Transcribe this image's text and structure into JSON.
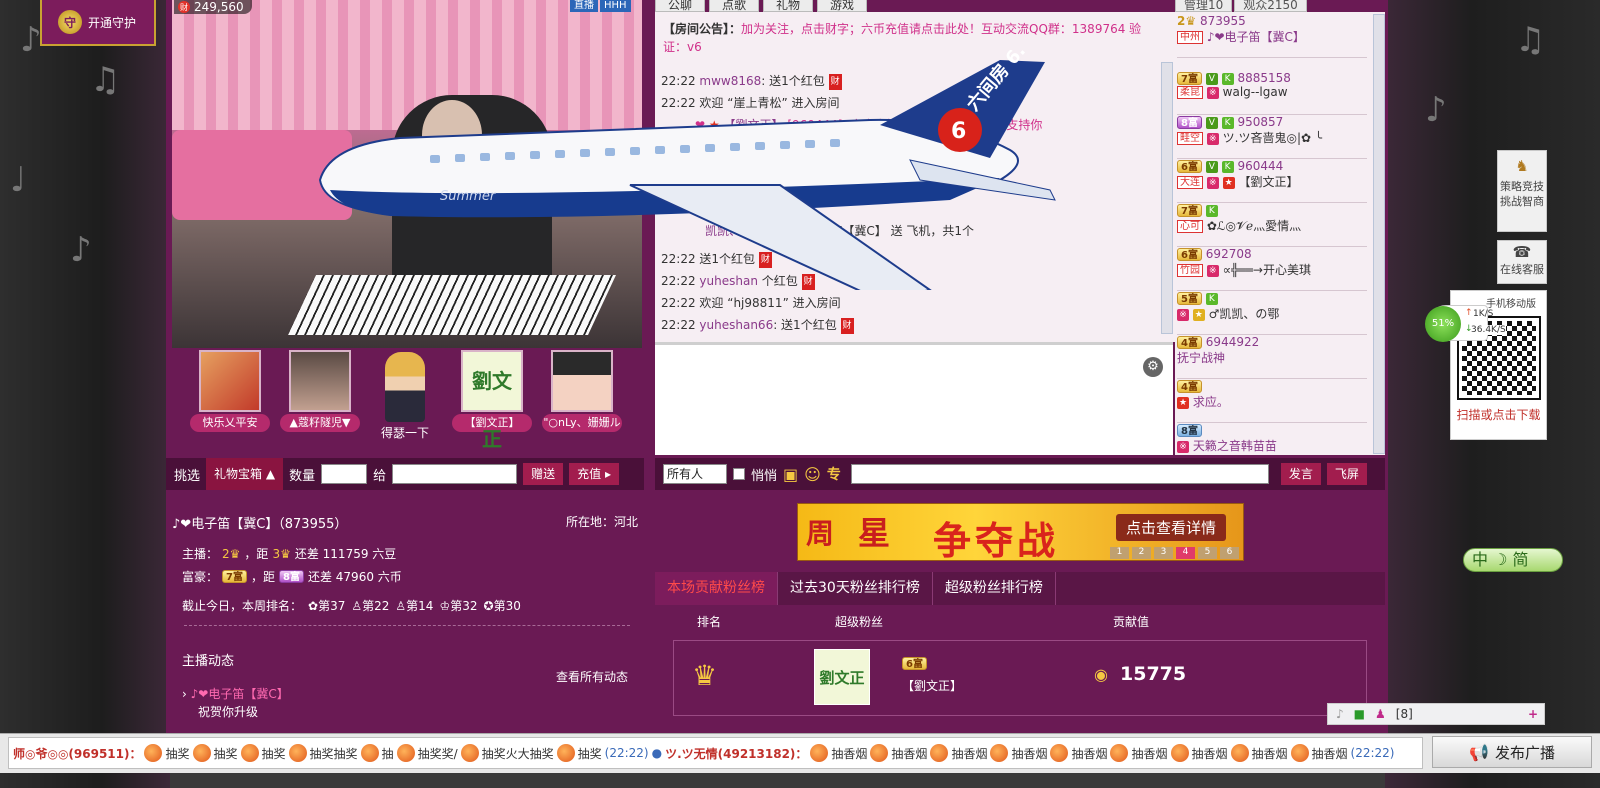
{
  "guard": {
    "label": "开通守护",
    "icon": "守"
  },
  "video": {
    "wealth_icon": "财",
    "wealth": "249,560",
    "tags": [
      "直播",
      "HHH"
    ]
  },
  "fans": [
    {
      "label": "快乐乂平安"
    },
    {
      "label": "▲蔻籽隧児▼"
    },
    {
      "label": "得瑟一下"
    },
    {
      "label": "【劉文正】"
    },
    {
      "label": "\"○nLy、姗姗ル"
    }
  ],
  "gift_bar": {
    "pick": "挑选",
    "box": "礼物宝箱",
    "qty": "数量",
    "to": "给",
    "send": "赠送",
    "recharge": "充值"
  },
  "profile": {
    "name": "♪❤电子笛【冀C】（873955）",
    "location": "所在地：河北",
    "anchor": "主播：",
    "anchor_gap": "，距",
    "anchor_diff": "还差 111759 六豆",
    "rich": "富豪：",
    "rich_gap": "，距",
    "rich_diff": "还差 47960 六币",
    "weekly": "截止今日，本周排名：",
    "ranks": [
      "第37",
      "第22",
      "第14",
      "第32",
      "第30"
    ],
    "dynamic_title": "主播动态",
    "view_all": "查看所有动态",
    "dyn_name": "♪❤电子笛【冀C】",
    "dyn_text": "祝贺你升级"
  },
  "chat": {
    "tabs": [
      "公聊",
      "点歌",
      "礼物",
      "游戏"
    ],
    "notice_label": "【房间公告】：",
    "notice": "加为关注，点击财字；六币充值请点击此处！互动交流QQ群：1389764 验证：v6",
    "messages": [
      {
        "time": "22:22",
        "user": "mww8168",
        "text": ": 送1个红包"
      },
      {
        "time": "22:22",
        "user": "",
        "text": "欢迎 “崖上青松” 进入房间"
      },
      {
        "time": "",
        "user": "【劉文正】",
        "text": "[960444]: 点击直播室……字刷免费红包支持你"
      },
      {
        "time": "",
        "user": "凯凯、の鄂",
        "text": ": 向 ♪❤电子笛【冀C】 送  飞机，共1个"
      },
      {
        "time": "22:22",
        "user": "",
        "text": "送1个红包"
      },
      {
        "time": "22:22",
        "user": "yuheshan",
        "text": "个红包"
      },
      {
        "time": "22:22",
        "user": "",
        "text": "欢迎 “hj98811” 进入房间"
      },
      {
        "time": "22:22",
        "user": "yuheshan66",
        "text": ": 送1个红包"
      }
    ],
    "plane_text": "Summer",
    "plane_brand": "六间房 6.cn"
  },
  "send_bar": {
    "target": "所有人",
    "whisper": "悄悄",
    "send": "发言",
    "fly": "飞屏"
  },
  "user_list": {
    "tabs": [
      "管理10",
      "观众2150"
    ],
    "users": [
      {
        "badge": "2",
        "loc": "中州",
        "id": "873955",
        "name": "♪❤电子笛【冀C】"
      },
      {
        "badge": "7",
        "loc": "柔昆",
        "id": "8885158",
        "name": "walg--lgaw"
      },
      {
        "badge": "8",
        "loc": "畦空",
        "id": "950857",
        "name": "ツ.ツ吝啬鬼◎|✿ ╰"
      },
      {
        "badge": "6",
        "loc": "大连",
        "id": "960444",
        "name": "【劉文正】"
      },
      {
        "badge": "7",
        "loc": "心可",
        "id": "",
        "name": "✿ℒ◎𝓥ℯ灬愛情灬"
      },
      {
        "badge": "6",
        "loc": "竹园",
        "id": "692708",
        "name": "∝╬══→开心美琪"
      },
      {
        "badge": "5",
        "loc": "",
        "id": "",
        "name": "♂凯凯、の鄂"
      },
      {
        "badge": "4",
        "loc": "",
        "id": "6944922",
        "name": "抚宁战神"
      },
      {
        "badge": "4",
        "loc": "",
        "id": "",
        "name": "求应。"
      },
      {
        "badge": "8",
        "loc": "",
        "id": "",
        "name": "天籁之音韩苗苗"
      }
    ]
  },
  "banner": {
    "left": "周",
    "mid": "星",
    "title": "争夺战",
    "cta": "点击查看详情",
    "pages": [
      "1",
      "2",
      "3",
      "4",
      "5",
      "6"
    ]
  },
  "ranking": {
    "tabs": [
      "本场贡献粉丝榜",
      "过去30天粉丝排行榜",
      "超级粉丝排行榜"
    ],
    "headers": [
      "排名",
      "超级粉丝",
      "贡献值"
    ],
    "row": {
      "name": "【劉文正】",
      "badge": "6",
      "value": "15775"
    }
  },
  "side": {
    "strategy": "策略竞技挑战智商",
    "service": "在线客服",
    "qr_title": "手机移动版",
    "qr_cta": "扫描或点击下载",
    "cpu": "51%",
    "up": "1K/S",
    "down": "36.4K/S",
    "jian": "中 ☽ 简",
    "people": "[8]"
  },
  "ticker": {
    "user1": "师◎爷◎◎(969511)：",
    "items1": [
      "抽奖",
      "抽奖",
      "抽奖",
      "抽奖抽奖",
      "抽",
      "抽奖奖/",
      "抽奖火大抽奖",
      "抽奖"
    ],
    "time1": "(22:22)",
    "user2": "ツ.ツ无情(49213182)：",
    "items2": [
      "抽香烟",
      "抽香烟",
      "抽香烟",
      "抽香烟",
      "抽香烟",
      "抽香烟",
      "抽香烟",
      "抽香烟",
      "抽香烟"
    ],
    "time2": "(22:22)",
    "broadcast": "发布广播"
  }
}
